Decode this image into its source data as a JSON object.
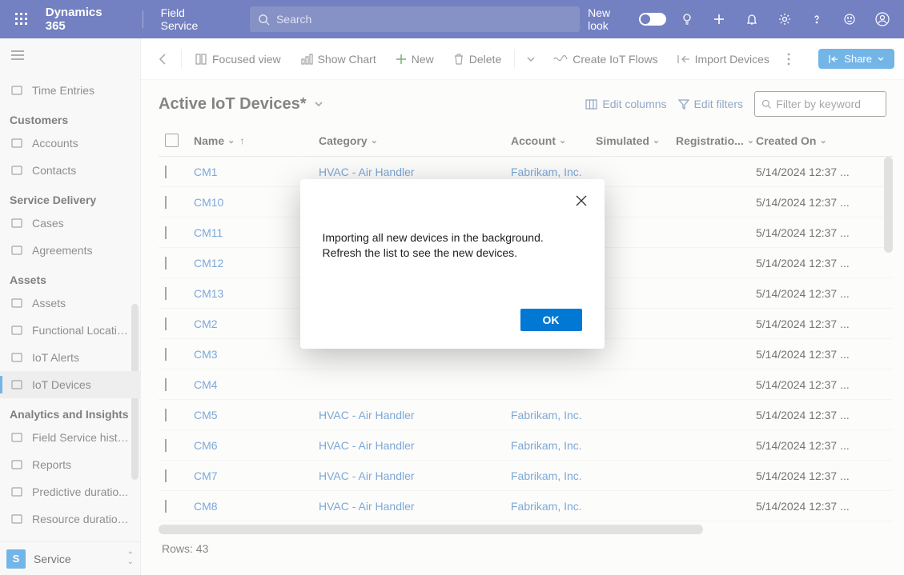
{
  "topbar": {
    "title": "Dynamics 365",
    "subtitle": "Field Service",
    "search_placeholder": "Search",
    "newlook_label": "New look"
  },
  "nav": {
    "top_item": "Time Entries",
    "groups": [
      {
        "label": "Customers",
        "items": [
          "Accounts",
          "Contacts"
        ]
      },
      {
        "label": "Service Delivery",
        "items": [
          "Cases",
          "Agreements"
        ]
      },
      {
        "label": "Assets",
        "items": [
          "Assets",
          "Functional Locatio...",
          "IoT Alerts",
          "IoT Devices"
        ]
      },
      {
        "label": "Analytics and Insights",
        "items": [
          "Field Service histo...",
          "Reports",
          "Predictive duratio...",
          "Resource duration..."
        ]
      }
    ],
    "active_item": "IoT Devices",
    "footer_badge": "S",
    "footer_label": "Service"
  },
  "cmdbar": {
    "focused_view": "Focused view",
    "show_chart": "Show Chart",
    "new": "New",
    "delete": "Delete",
    "create_flows": "Create IoT Flows",
    "import_devices": "Import Devices",
    "share": "Share"
  },
  "view": {
    "title": "Active IoT Devices*",
    "edit_columns": "Edit columns",
    "edit_filters": "Edit filters",
    "filter_placeholder": "Filter by keyword"
  },
  "grid": {
    "columns": [
      "Name",
      "Category",
      "Account",
      "Simulated",
      "Registratio...",
      "Created On"
    ],
    "rows": [
      {
        "name": "CM1",
        "category": "HVAC - Air Handler",
        "account": "Fabrikam, Inc.",
        "simulated": "",
        "reg": "",
        "created": "5/14/2024 12:37 ..."
      },
      {
        "name": "CM10",
        "category": "",
        "account": "",
        "simulated": "",
        "reg": "",
        "created": "5/14/2024 12:37 ..."
      },
      {
        "name": "CM11",
        "category": "",
        "account": "",
        "simulated": "",
        "reg": "",
        "created": "5/14/2024 12:37 ..."
      },
      {
        "name": "CM12",
        "category": "",
        "account": "",
        "simulated": "",
        "reg": "",
        "created": "5/14/2024 12:37 ..."
      },
      {
        "name": "CM13",
        "category": "",
        "account": "",
        "simulated": "",
        "reg": "",
        "created": "5/14/2024 12:37 ..."
      },
      {
        "name": "CM2",
        "category": "",
        "account": "",
        "simulated": "",
        "reg": "",
        "created": "5/14/2024 12:37 ..."
      },
      {
        "name": "CM3",
        "category": "",
        "account": "",
        "simulated": "",
        "reg": "",
        "created": "5/14/2024 12:37 ..."
      },
      {
        "name": "CM4",
        "category": "",
        "account": "",
        "simulated": "",
        "reg": "",
        "created": "5/14/2024 12:37 ..."
      },
      {
        "name": "CM5",
        "category": "HVAC - Air Handler",
        "account": "Fabrikam, Inc.",
        "simulated": "",
        "reg": "",
        "created": "5/14/2024 12:37 ..."
      },
      {
        "name": "CM6",
        "category": "HVAC - Air Handler",
        "account": "Fabrikam, Inc.",
        "simulated": "",
        "reg": "",
        "created": "5/14/2024 12:37 ..."
      },
      {
        "name": "CM7",
        "category": "HVAC - Air Handler",
        "account": "Fabrikam, Inc.",
        "simulated": "",
        "reg": "",
        "created": "5/14/2024 12:37 ..."
      },
      {
        "name": "CM8",
        "category": "HVAC - Air Handler",
        "account": "Fabrikam, Inc.",
        "simulated": "",
        "reg": "",
        "created": "5/14/2024 12:37 ..."
      }
    ],
    "footer": "Rows: 43"
  },
  "dialog": {
    "message": "Importing all new devices in the background. Refresh the list to see the new devices.",
    "ok": "OK"
  },
  "nav_icons": {
    "top_item": "time-entries-icon",
    "Accounts": "building-icon",
    "Contacts": "person-icon",
    "Cases": "wrench-icon",
    "Agreements": "document-icon",
    "Assets": "box-icon",
    "Functional Locatio...": "location-icon",
    "IoT Alerts": "alert-icon",
    "IoT Devices": "device-icon",
    "Field Service histo...": "dashboard-icon",
    "Reports": "dashboard-icon",
    "Predictive duratio...": "dashboard-icon",
    "Resource duration...": "dashboard-icon"
  }
}
